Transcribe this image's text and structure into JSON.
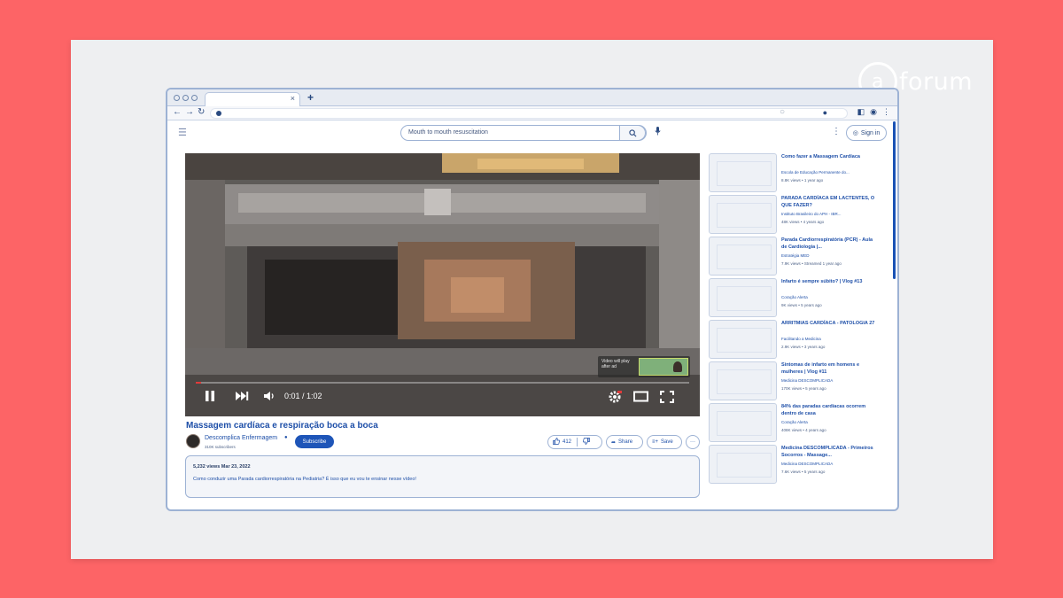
{
  "brand": {
    "logo_text": "forum",
    "logo_mark": "a"
  },
  "browser": {
    "new_tab_label": "+",
    "tab_close": "×"
  },
  "search": {
    "query": "Mouth to mouth resuscitation"
  },
  "header": {
    "signin_label": "Sign in"
  },
  "video": {
    "time": "0:01 / 1:02",
    "progress_fraction": 0.01,
    "endscreen_text": "Video will play after ad",
    "title": "Massagem cardíaca e respiração boca a boca",
    "channel_name": "Descomplica Enfermagem",
    "subscribers": "310K subscribers",
    "subscribe_label": "Subscribe",
    "likes": "412",
    "share_label": "Share",
    "save_label": "Save",
    "views_date": "5,232 views  Mar 23, 2022",
    "description": "Como conduzir uma Parada cardiorrespiratória na Pediatria? É isso que eu vou te ensinar nesse vídeo!"
  },
  "recommendations": [
    {
      "title": "Como fazer a Massagem Cardíaca",
      "channel": "Escola de Educação Permanente do...",
      "meta": "8.8K views  •  1 year ago"
    },
    {
      "title": "PARADA CARDÍACA EM LACTENTES, O QUE FAZER?",
      "channel": "Instituto Brasileiro do APH - IBR...",
      "meta": "48K views  •  4 years ago"
    },
    {
      "title": "Parada Cardiorrespiratória (PCR) - Aula de Cardiologia |...",
      "channel": "Estratégia MED",
      "meta": "7.9K views  •  Streamed 1 year ago"
    },
    {
      "title": "Infarto é sempre súbito? | Vlog #13",
      "channel": "Coração Alerta",
      "meta": "9K views  •  5 years ago"
    },
    {
      "title": "ARRITMIAS CARDÍACA - PATOLOGIA 27",
      "channel": "Facilitando a Medicina",
      "meta": "2.9K views  •  3 years ago"
    },
    {
      "title": "Sintomas de infarto em homens e mulheres | Vlog #11",
      "channel": "Medicina DESCOMPLICADA",
      "meta": "170K views  •  5 years ago"
    },
    {
      "title": "84% das paradas cardíacas ocorrem dentro de casa",
      "channel": "Coração Alerta",
      "meta": "408K views  •  4 years ago"
    },
    {
      "title": "Medicina DESCOMPLICADA - Primeiros Socorros - Massage...",
      "channel": "Medicina DESCOMPLICADA",
      "meta": "7.6K views  •  5 years ago"
    }
  ]
}
